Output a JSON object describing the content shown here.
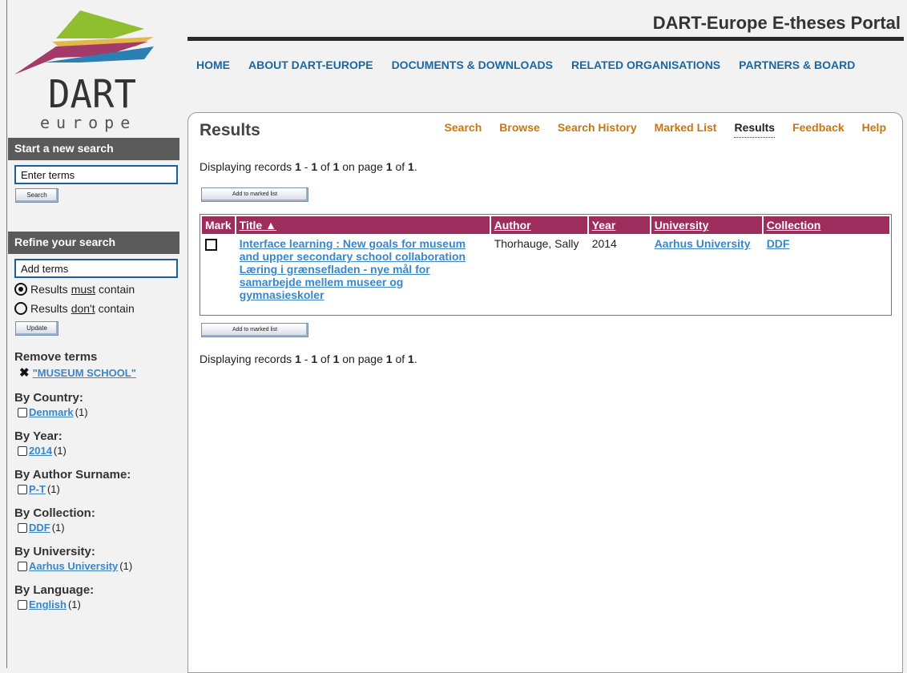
{
  "site": {
    "title": "DART-Europe E-theses Portal"
  },
  "logo": {
    "text_top": "DART",
    "text_bottom": "europe"
  },
  "topnav": [
    "HOME",
    "ABOUT DART-EUROPE",
    "DOCUMENTS & DOWNLOADS",
    "RELATED ORGANISATIONS",
    "PARTNERS & BOARD"
  ],
  "sidebar": {
    "new_search": {
      "heading": "Start a new search",
      "input_value": "Enter terms",
      "button": "Search"
    },
    "refine": {
      "heading": "Refine your search",
      "input_value": "Add terms",
      "radio_must": {
        "pre": "Results ",
        "u": "must",
        "post": " contain"
      },
      "radio_dont": {
        "pre": "Results ",
        "u": "don't",
        "post": " contain"
      },
      "button": "Update"
    },
    "remove_terms": {
      "heading": "Remove terms",
      "term": "\"MUSEUM SCHOOL\""
    },
    "facets": [
      {
        "heading": "By Country:",
        "link": "Denmark",
        "count": "(1)"
      },
      {
        "heading": "By Year:",
        "link": "2014",
        "count": "(1)"
      },
      {
        "heading": "By Author Surname:",
        "link": "P-T",
        "count": "(1)"
      },
      {
        "heading": "By Collection:",
        "link": "DDF",
        "count": "(1)"
      },
      {
        "heading": "By University:",
        "link": "Aarhus University",
        "count": "(1)"
      },
      {
        "heading": "By Language:",
        "link": "English",
        "count": "(1)"
      }
    ]
  },
  "main": {
    "title": "Results",
    "subnav": [
      "Search",
      "Browse",
      "Search History",
      "Marked List",
      "Results",
      "Feedback",
      "Help"
    ],
    "active_tab": "Results",
    "display": {
      "prefix": "Displaying records ",
      "from": "1",
      "sep": " - ",
      "to": "1",
      "of_label": " of ",
      "total": "1",
      "page_label": " on page ",
      "page": "1",
      "of_pages_label": " of ",
      "pages": "1",
      "end": "."
    },
    "add_button": "Add to marked list",
    "table": {
      "headers": {
        "mark": "Mark",
        "title": "Title ▲",
        "author": "Author",
        "year": "Year",
        "university": "University",
        "collection": "Collection"
      },
      "rows": [
        {
          "title": "Interface learning : New goals for museum and upper secondary school collaboration Læring i grænsefladen - nye mål for samarbejde mellem museer og gymnasieskoler",
          "author": "Thorhauge, Sally",
          "year": "2014",
          "university": "Aarhus University",
          "collection": "DDF"
        }
      ]
    }
  },
  "colors": {
    "nav_blue": "#1a67a3",
    "link_blue": "#3b86c9",
    "subnav_orange": "#c8760f",
    "table_header": "#9c2d5d",
    "sidebar_header": "#5a5a5a"
  }
}
